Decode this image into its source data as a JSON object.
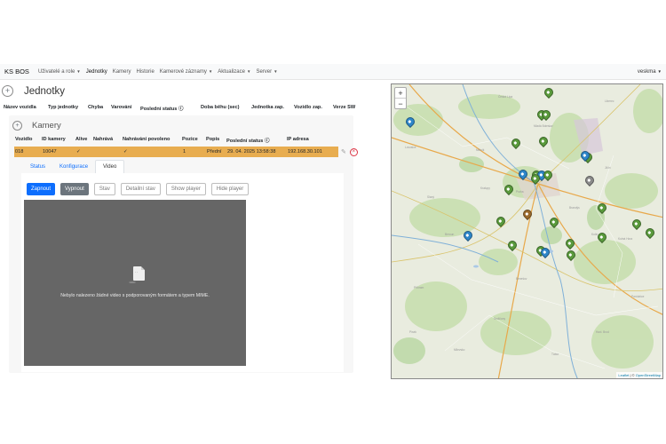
{
  "navbar": {
    "brand": "KS BOS",
    "items": [
      {
        "label": "Uživatelé a role",
        "caret": true,
        "active": false
      },
      {
        "label": "Jednotky",
        "caret": false,
        "active": true
      },
      {
        "label": "Kamery",
        "caret": false,
        "active": false
      },
      {
        "label": "Historie",
        "caret": false,
        "active": false
      },
      {
        "label": "Kamerové záznamy",
        "caret": true,
        "active": false
      },
      {
        "label": "Aktualizace",
        "caret": true,
        "active": false
      },
      {
        "label": "Server",
        "caret": true,
        "active": false
      }
    ],
    "user": "veskma"
  },
  "units": {
    "title": "Jednotky",
    "columns": [
      "Název vozidla",
      "Typ jednotky",
      "Chyba",
      "Varování",
      "Poslední status",
      "Doba běhu (sec)",
      "Jednotka zap.",
      "Vozidlo zap.",
      "Verze SW"
    ]
  },
  "cameras": {
    "title": "Kamery",
    "columns": [
      "Vozidlo",
      "ID kamery",
      "Alive",
      "Nahrává",
      "Nahrávání povoleno",
      "Pozice",
      "Popis",
      "Poslední status",
      "IP adresa"
    ],
    "row": [
      "018",
      "10047",
      "✓",
      "",
      "✓",
      "1",
      "Přední",
      "29. 04. 2025 13:58:38",
      "192.168.30.101"
    ]
  },
  "tabs": [
    {
      "label": "Status",
      "active": false
    },
    {
      "label": "Konfigurace",
      "active": false
    },
    {
      "label": "Video",
      "active": true
    }
  ],
  "buttons": {
    "on": "Zapnout",
    "off": "Vypnout",
    "state": "Stav",
    "detail": "Detailní stav",
    "show": "Show player",
    "hide": "Hide player"
  },
  "video": {
    "message": "Nebylo nalezeno žádné video s podporovaným formátem a typem MIME."
  },
  "map": {
    "zoom_in": "+",
    "zoom_out": "−",
    "attribution_leaflet": "Leaflet",
    "attribution_sep": " | © ",
    "attribution_osm": "OpenStreetMap",
    "pin_colors": {
      "green": "#5a9a3c",
      "blue": "#2e86c9",
      "gray": "#8a8a8a",
      "brown": "#9a6a2c"
    }
  }
}
